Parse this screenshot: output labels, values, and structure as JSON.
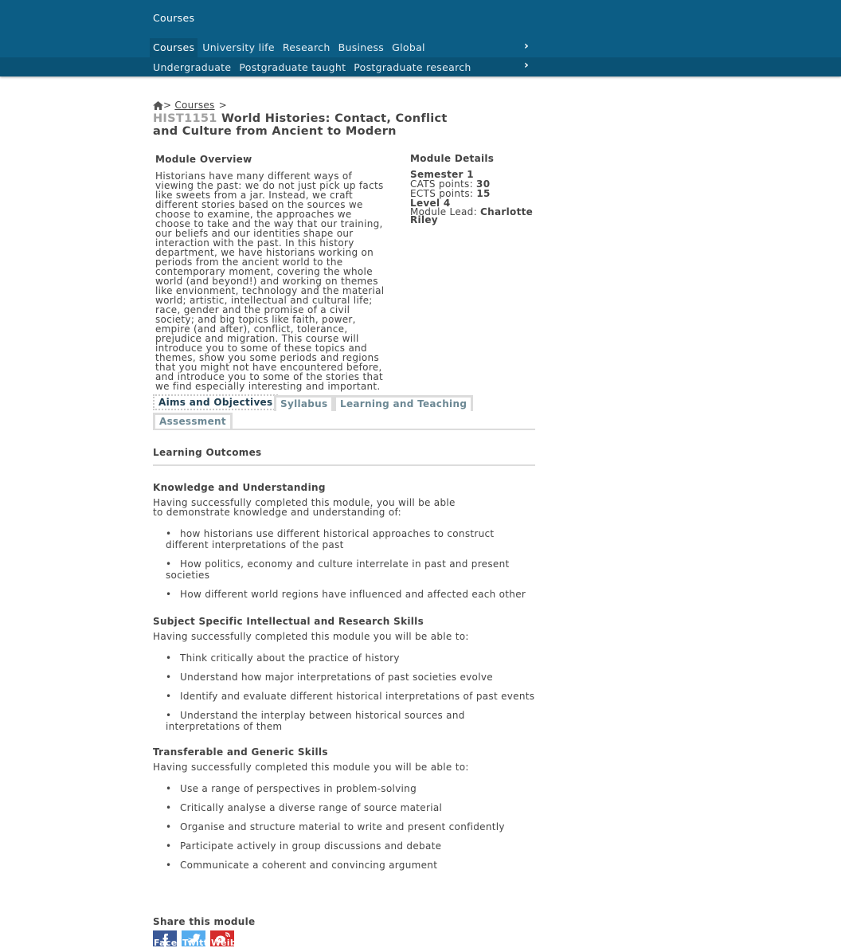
{
  "header": {
    "site_title": "Courses",
    "primary_nav": [
      "Courses",
      "University life",
      "Research",
      "Business",
      "Global"
    ],
    "primary_active": "Courses",
    "secondary_nav": [
      "Undergraduate",
      "Postgraduate taught",
      "Postgraduate research"
    ],
    "chevron": "›"
  },
  "breadcrumb": {
    "home_icon": "home-icon",
    "sep": ">",
    "items": [
      "Courses"
    ]
  },
  "module": {
    "code": "HIST1151",
    "title": "World Histories: Contact, Conflict and Culture from Ancient to Modern"
  },
  "overview": {
    "heading": "Module Overview",
    "text": "Historians have many different ways of viewing the past: we do not just pick up facts like sweets from a jar. Instead, we craft different stories based on the sources we choose to examine, the approaches we choose to take and the way that our training, our beliefs and our identities shape our interaction with the past. In this history department, we have historians working on periods from the ancient world to the contemporary moment, covering the whole world (and beyond!) and working on themes like envionment, technology and the material world; artistic, intellectual and cultural life; race, gender and the promise of a civil society; and big topics like faith, power, empire (and after), conflict, tolerance, prejudice and migration. This course will introduce you to some of these topics and themes, show you some periods and regions that you might not have encountered before, and introduce you to some of the stories that we find especially interesting and important."
  },
  "details": {
    "heading": "Module Details",
    "semester": "Semester 1",
    "cats_label": "CATS points:",
    "cats_value": "30",
    "ects_label": "ECTS points:",
    "ects_value": "15",
    "level": "Level 4",
    "lead_label": "Module Lead:",
    "lead_value": "Charlotte Riley"
  },
  "tabs": [
    {
      "label": "Aims and Objectives",
      "active": true
    },
    {
      "label": "Syllabus",
      "active": false
    },
    {
      "label": "Learning and Teaching",
      "active": false
    },
    {
      "label": "Assessment",
      "active": false
    }
  ],
  "learning_outcomes": {
    "heading": "Learning Outcomes",
    "groups": [
      {
        "heading": "Knowledge and Understanding",
        "intro": "Having successfully completed this module, you will be able to demonstrate knowledge and understanding of:",
        "items": [
          "how historians use different historical approaches to construct different interpretations of the past",
          "How politics, economy and culture interrelate in past and present societies",
          "How different world regions have influenced and affected each other"
        ]
      },
      {
        "heading": "Subject Specific Intellectual and Research Skills",
        "intro": "Having successfully completed this module you will be able to:",
        "items": [
          "Think critically about the practice of history",
          "Understand how major interpretations of past societies evolve",
          "Identify and evaluate different historical interpretations of past events",
          "Understand the interplay between historical sources and interpretations of them"
        ]
      },
      {
        "heading": "Transferable and Generic Skills",
        "intro": "Having successfully completed this module you will be able to:",
        "items": [
          "Use a range of perspectives in problem-solving",
          "Critically analyse a diverse range of source material",
          "Organise and structure material to write and present confidently",
          "Participate actively in group discussions and debate",
          "Communicate a coherent and convincing argument"
        ]
      }
    ]
  },
  "share": {
    "heading": "Share this module",
    "buttons": [
      {
        "label": "Facebook",
        "icon": "facebook-icon",
        "color": "#3b5998"
      },
      {
        "label": "Twitter",
        "icon": "twitter-icon",
        "color": "#55acee"
      },
      {
        "label": "Weibo",
        "icon": "weibo-icon",
        "color": "#d52b2b"
      }
    ]
  },
  "colors": {
    "header": "#0c5d85",
    "subnav": "#0a5275",
    "tab_border": "#dcdcdc"
  }
}
